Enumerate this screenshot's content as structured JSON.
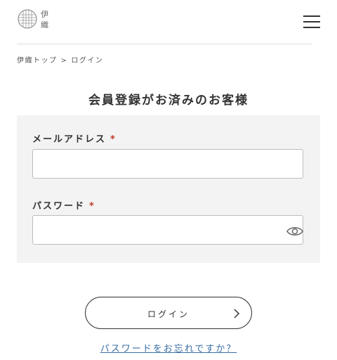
{
  "header": {
    "logo_text": "伊織",
    "menu_icon": "hamburger-menu-icon"
  },
  "breadcrumb": {
    "home": "伊織トップ",
    "separator": ">",
    "current": "ログイン"
  },
  "section_title": "会員登録がお済みのお客様",
  "form": {
    "email_label": "メールアドレス",
    "email_value": "",
    "password_label": "パスワード",
    "password_value": "",
    "required_mark": "*",
    "password_toggle_icon": "eye-icon"
  },
  "login_button": {
    "label": "ログイン",
    "icon": "chevron-right-icon"
  },
  "forgot_link": "パスワードをお忘れですか？",
  "colors": {
    "required": "#c0392b",
    "link": "#3a6ea5",
    "panel_bg": "#f3f3f3"
  }
}
